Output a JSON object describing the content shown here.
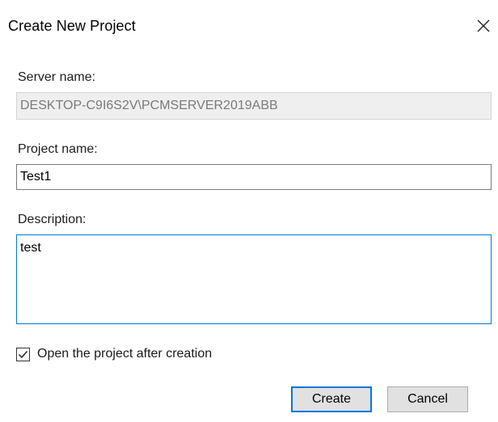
{
  "dialog": {
    "title": "Create New Project",
    "close_icon": "close-icon"
  },
  "server": {
    "label": "Server name:",
    "value": "DESKTOP-C9I6S2V\\PCMSERVER2019ABB"
  },
  "project": {
    "label": "Project name:",
    "value": "Test1"
  },
  "description": {
    "label": "Description:",
    "value": "test"
  },
  "open_after": {
    "label": "Open the project after creation",
    "checked": true,
    "icon": "checkmark-icon"
  },
  "buttons": {
    "create_label": "Create",
    "cancel_label": "Cancel"
  },
  "colors": {
    "accent": "#0078d7",
    "readonly_bg": "#efefef",
    "button_bg": "#e1e1e1"
  }
}
